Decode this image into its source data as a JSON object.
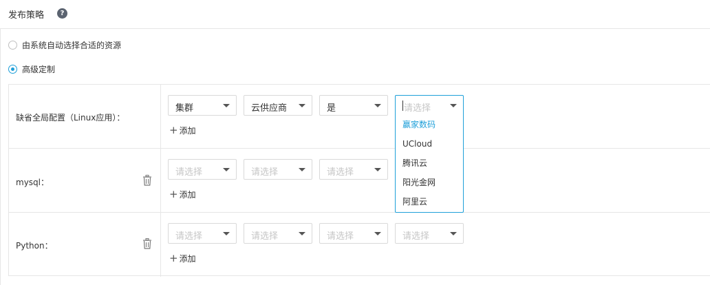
{
  "header": {
    "title": "发布策略",
    "help_glyph": "?"
  },
  "strategy": {
    "auto_label": "由系统自动选择合适的资源",
    "custom_label": "高级定制",
    "selected": "custom"
  },
  "rows": [
    {
      "label": "缺省全局配置（Linux应用）：",
      "deletable": false,
      "selects": [
        "集群",
        "云供应商",
        "是",
        "请选择"
      ],
      "add_label": "添加"
    },
    {
      "label": "mysql：",
      "deletable": true,
      "selects": [
        "请选择",
        "请选择",
        "请选择"
      ],
      "add_label": "添加"
    },
    {
      "label": "Python：",
      "deletable": true,
      "selects": [
        "请选择",
        "请选择",
        "请选择",
        "请选择"
      ],
      "add_label": "添加"
    }
  ],
  "dropdown": {
    "options": [
      "赢家数码",
      "UCloud",
      "腾讯云",
      "阳光金网",
      "阿里云"
    ],
    "highlighted": "赢家数码"
  },
  "colors": {
    "accent": "#1d9fd9",
    "border": "#e6e6e6",
    "placeholder": "#c6c6c6"
  }
}
